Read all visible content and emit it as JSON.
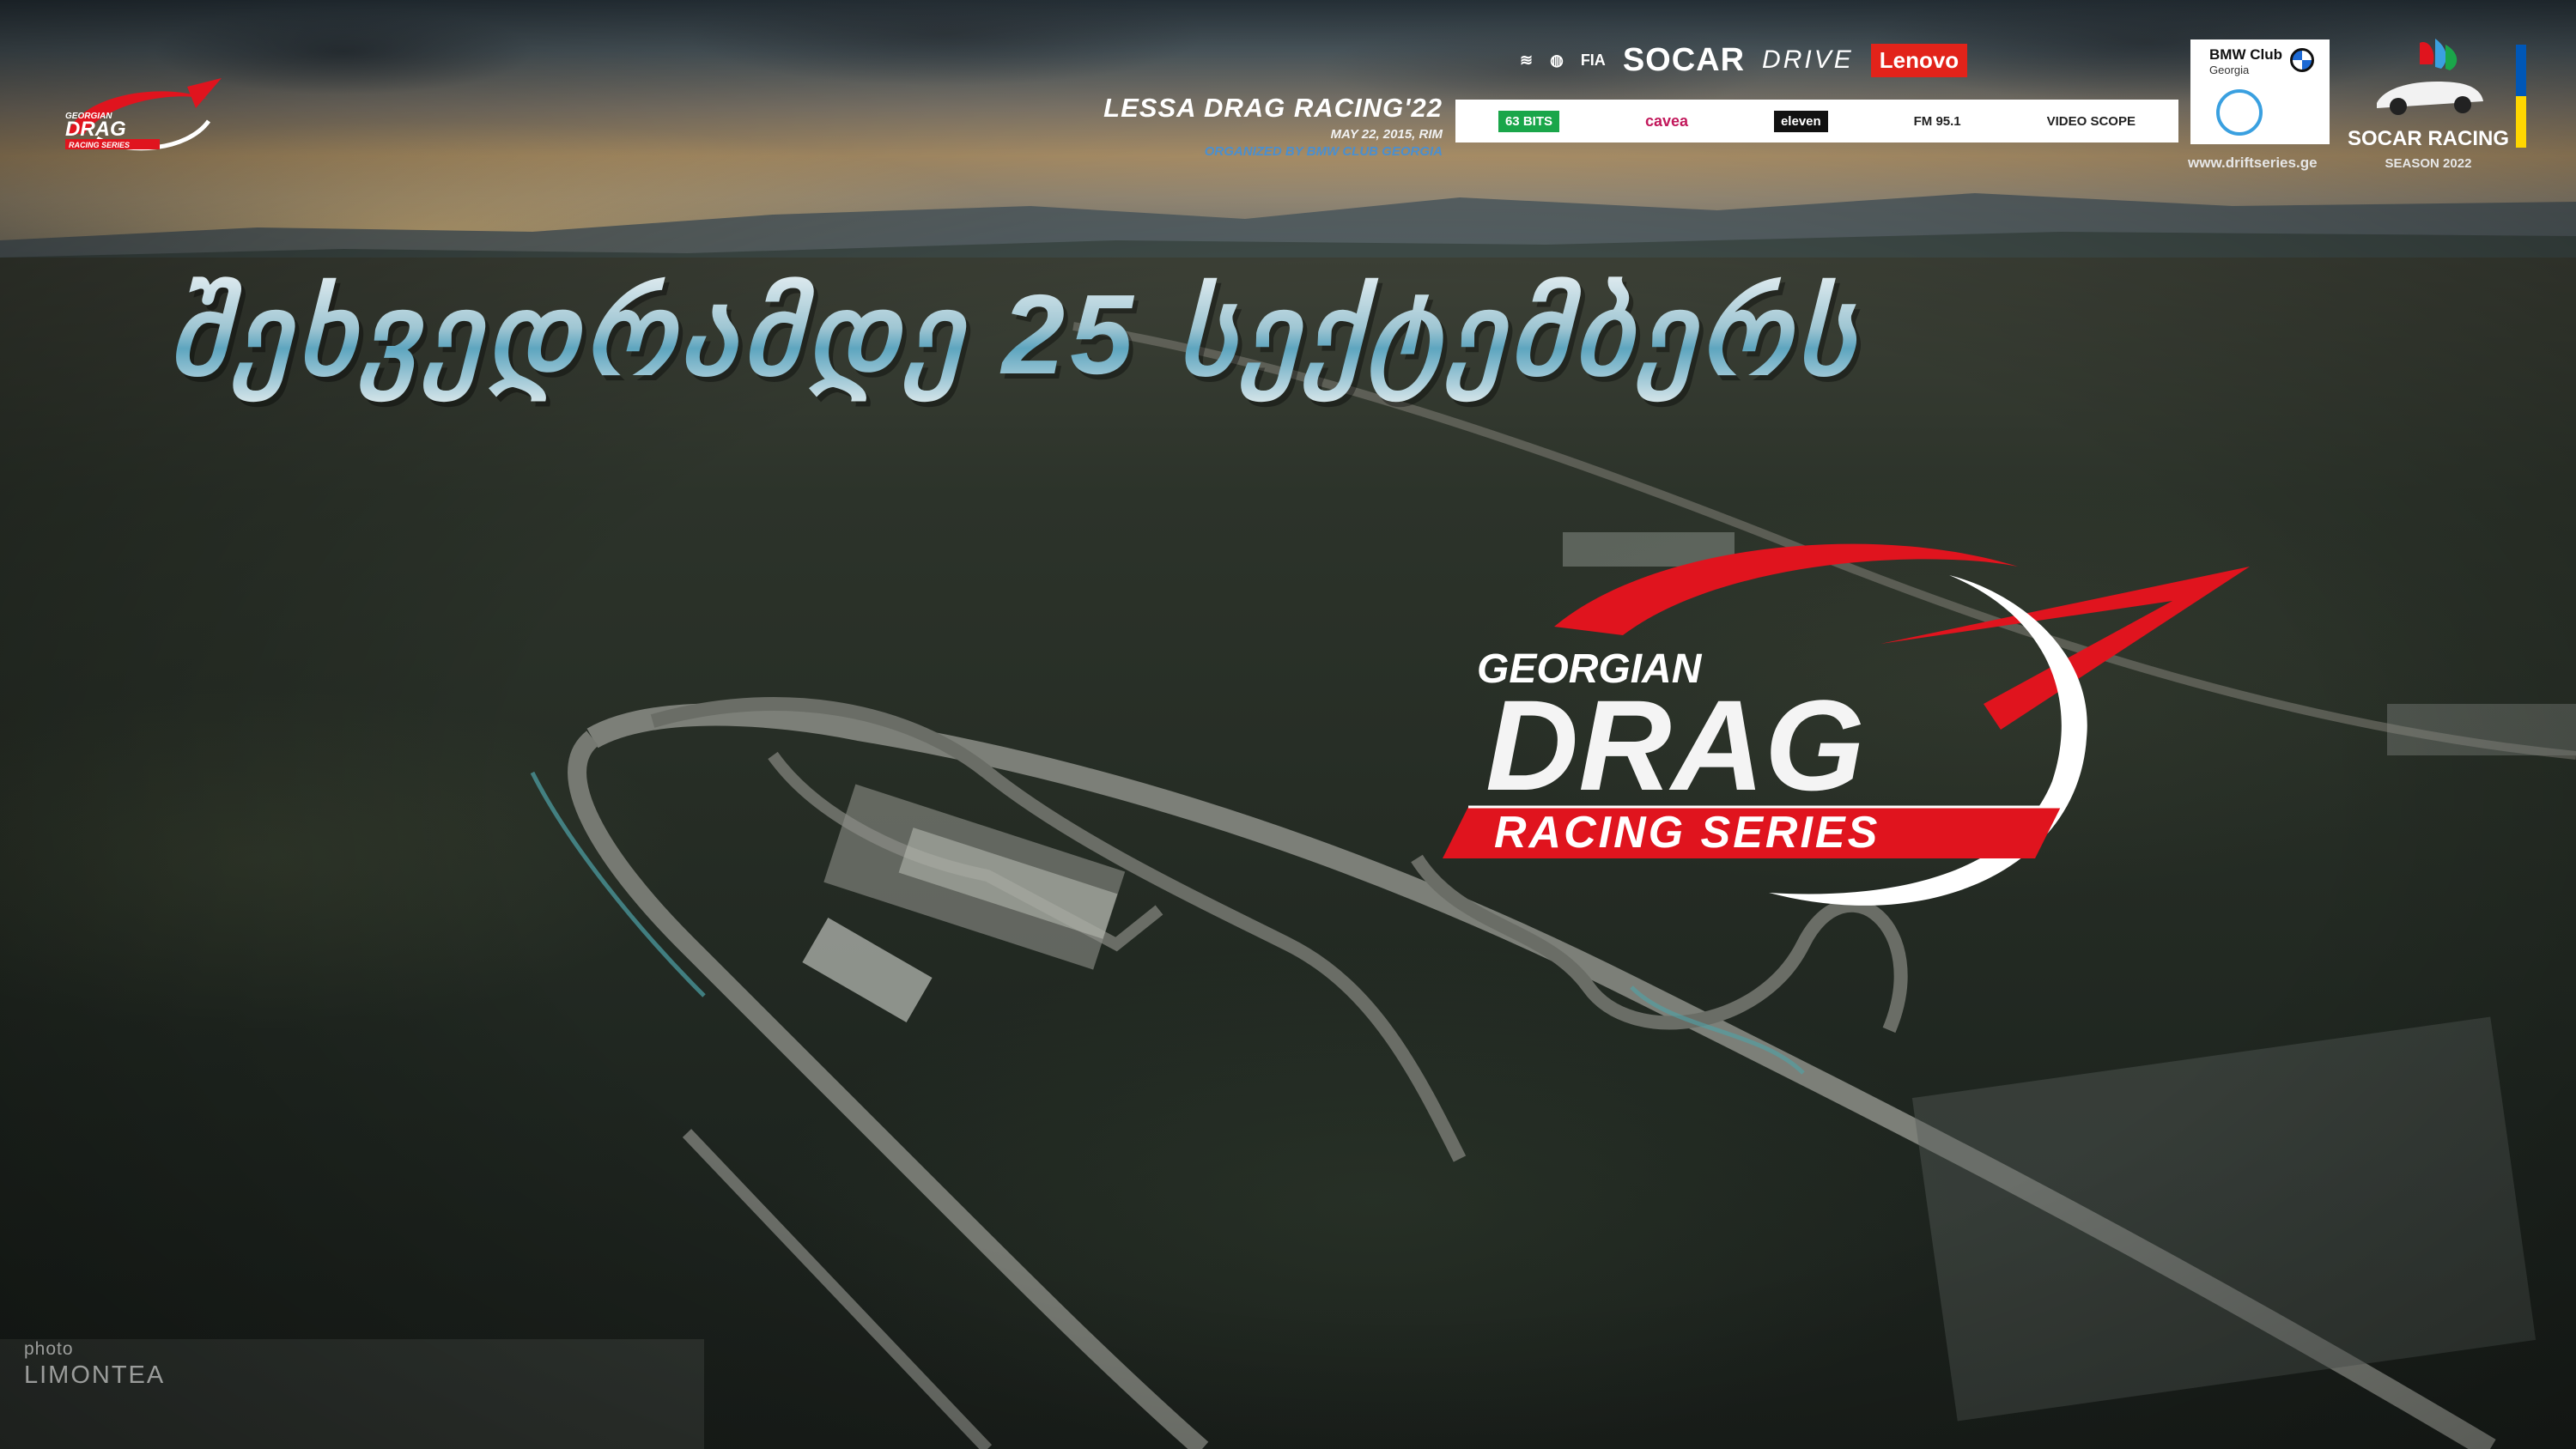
{
  "headline": "შეხვედრამდე 25 სექტემბერს",
  "event": {
    "title": "LESSA DRAG RACING'22",
    "date": "MAY 22, 2015, RIM",
    "organizer": "ORGANIZED BY BMW CLUB GEORGIA"
  },
  "sponsors": {
    "top": [
      "FIA",
      "SOCAR",
      "DRIVE",
      "Lenovo"
    ],
    "bar": [
      "63 BITS",
      "cavea",
      "eleven",
      "FM 95.1",
      "VIDEO SCOPE"
    ]
  },
  "bmw_club": {
    "name": "BMW Club",
    "country": "Georgia",
    "url": "www.driftseries.ge"
  },
  "socar_racing": {
    "title": "SOCAR RACING",
    "season": "SEASON 2022"
  },
  "logo": {
    "line1": "GEORGIAN",
    "line2": "DRAG",
    "line3": "RACING SERIES"
  },
  "credit": {
    "label": "photo",
    "name": "LIMONTEA"
  },
  "colors": {
    "accent_red": "#e0141e",
    "headline_blue": "#5ea5bf",
    "org_blue": "#4a8fd0"
  }
}
